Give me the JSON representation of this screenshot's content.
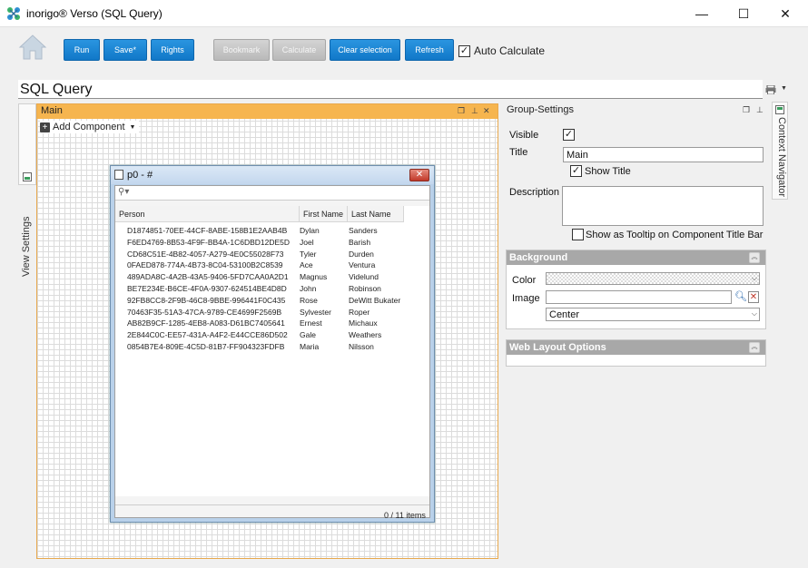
{
  "window": {
    "title": "inorigo® Verso (SQL Query)",
    "controls": {
      "minimize": "—",
      "maximize": "☐",
      "close": "✕"
    }
  },
  "toolbar": {
    "run": "Run",
    "save": "Save*",
    "rights": "Rights",
    "bookmark": "Bookmark",
    "calculate": "Calculate",
    "clear_selection": "Clear selection",
    "refresh": "Refresh",
    "auto_calculate_label": "Auto Calculate",
    "auto_calculate_checked": true
  },
  "page_title": "SQL Query",
  "left_strip": {
    "label": "View Settings"
  },
  "right_strip": {
    "label": "Context Navigator"
  },
  "main_panel": {
    "title": "Main",
    "add_component": "Add Component"
  },
  "grid_window": {
    "title": "p0 - #",
    "search_placeholder": "",
    "columns": [
      "Person",
      "First Name",
      "Last Name"
    ],
    "rows": [
      {
        "person": "D1874851-70EE-44CF-8ABE-158B1E2AAB4B",
        "first": "Dylan",
        "last": "Sanders"
      },
      {
        "person": "F6ED4769-8B53-4F9F-BB4A-1C6DBD12DE5D",
        "first": "Joel",
        "last": "Barish"
      },
      {
        "person": "CD68C51E-4B82-4057-A279-4E0C55028F73",
        "first": "Tyler",
        "last": "Durden"
      },
      {
        "person": "0FAED878-774A-4B73-8C04-53100B2C8539",
        "first": "Ace",
        "last": "Ventura"
      },
      {
        "person": "489ADA8C-4A2B-43A5-9406-5FD7CAA0A2D1",
        "first": "Magnus",
        "last": "Videlund"
      },
      {
        "person": "BE7E234E-B6CE-4F0A-9307-624514BE4D8D",
        "first": "John",
        "last": "Robinson"
      },
      {
        "person": "92FB8CC8-2F9B-46C8-9BBE-996441F0C435",
        "first": "Rose",
        "last": "DeWitt Bukater"
      },
      {
        "person": "70463F35-51A3-47CA-9789-CE4699F2569B",
        "first": "Sylvester",
        "last": "Roper"
      },
      {
        "person": "AB82B9CF-1285-4EB8-A083-D61BC7405641",
        "first": "Ernest",
        "last": "Michaux"
      },
      {
        "person": "2E844C0C-EE57-431A-A4F2-E44CCE86D502",
        "first": "Gale",
        "last": "Weathers"
      },
      {
        "person": "0854B7E4-809E-4C5D-81B7-FF904323FDFB",
        "first": "Maria",
        "last": "Nilsson"
      }
    ],
    "footer": "0 / 11 items"
  },
  "group_settings": {
    "title": "Group-Settings",
    "visible_label": "Visible",
    "visible_checked": true,
    "title_label": "Title",
    "title_value": "Main",
    "show_title_label": "Show Title",
    "show_title_checked": true,
    "description_label": "Description",
    "description_value": "",
    "tooltip_label": "Show as Tooltip on Component Title Bar",
    "tooltip_checked": false,
    "background": {
      "header": "Background",
      "color_label": "Color",
      "image_label": "Image",
      "image_value": "",
      "position_value": "Center"
    },
    "web_layout": {
      "header": "Web Layout Options"
    }
  },
  "colors": {
    "accent_blue": "#1178c8",
    "main_panel_header": "#f6b54f",
    "section_header": "#a8a8a8"
  }
}
